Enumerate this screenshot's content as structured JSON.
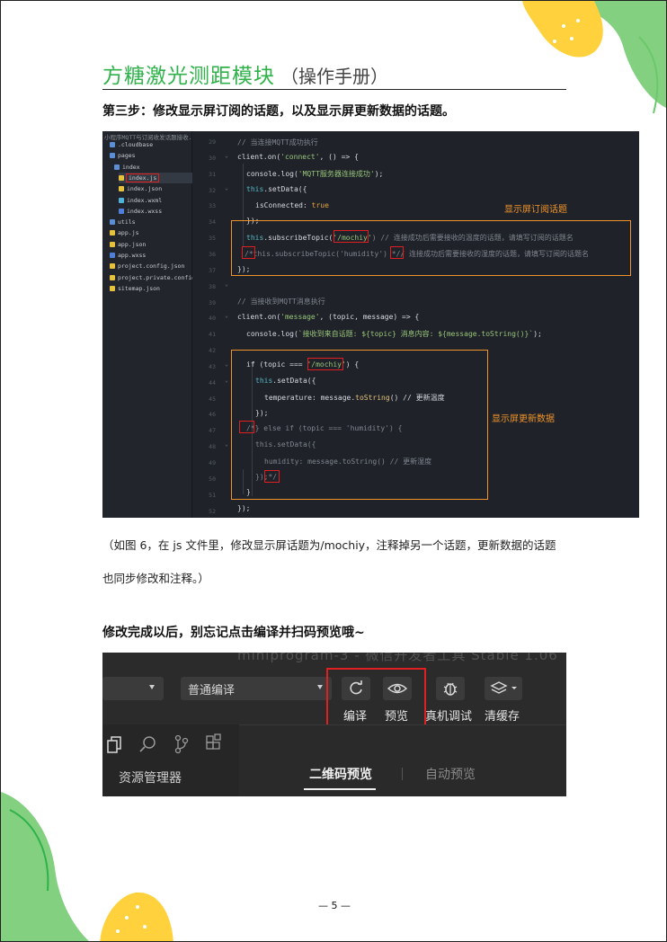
{
  "header": {
    "title": "方糖激光测距模块",
    "subtitle": "（操作手册）"
  },
  "step": {
    "heading": "第三步：修改显示屏订阅的话题，以及显示屏更新数据的话题。"
  },
  "editor": {
    "tree_header": "小程序MQTT与订阅收发话题接收...",
    "tree": [
      {
        "label": ".cloudbase",
        "kind": "folder"
      },
      {
        "label": "pages",
        "kind": "folder"
      },
      {
        "label": "index",
        "kind": "folder"
      },
      {
        "label": "index.js",
        "kind": "js"
      },
      {
        "label": "index.json",
        "kind": "json"
      },
      {
        "label": "index.wxml",
        "kind": "wxml"
      },
      {
        "label": "index.wxss",
        "kind": "wxss"
      },
      {
        "label": "utils",
        "kind": "folder"
      },
      {
        "label": "app.js",
        "kind": "js"
      },
      {
        "label": "app.json",
        "kind": "json"
      },
      {
        "label": "app.wxss",
        "kind": "wxss"
      },
      {
        "label": "project.config.json",
        "kind": "json"
      },
      {
        "label": "project.private.config.js...",
        "kind": "json"
      },
      {
        "label": "sitemap.json",
        "kind": "json"
      }
    ],
    "line_numbers": [
      "29",
      "30",
      "31",
      "32",
      "33",
      "34",
      "35",
      "36",
      "37",
      "38",
      "39",
      "40",
      "41",
      "42",
      "43",
      "44",
      "45",
      "46",
      "47",
      "48",
      "49",
      "50",
      "51",
      "52"
    ],
    "code_lines": {
      "l1": "// 当连接MQTT成功执行",
      "l2a": "client.on(",
      "l2b": "'connect'",
      "l2c": ", () => {",
      "l3a": "console.log(",
      "l3b": "'MQTT服务器连接成功'",
      "l3c": ");",
      "l4a": "this",
      "l4b": ".setData({",
      "l5a": "isConnected: ",
      "l5b": "true",
      "l6": "});",
      "l7a": "this",
      "l7b": ".subscribeTopic(",
      "l7c": "'/mochiy'",
      "l7d": ") // 连接成功后需要接收的温度的话题，请填写订阅的话题名",
      "l8a": "/*",
      "l8b": "this.subscribeTopic('humidity') ",
      "l8c": "*/",
      "l8d": "/ 连接成功后需要接收的湿度的话题，请填写订阅的话题名",
      "l9": "});",
      "l10": "// 当接收到MQTT消息执行",
      "l11a": "client.on(",
      "l11b": "'message'",
      "l11c": ", (topic, message) => {",
      "l12a": "console.log(",
      "l12b": "`接收到来自话题: ${topic} 消息内容: ${message.toString()}`",
      "l12c": ");",
      "l13a": "if (topic === ",
      "l13b": "'/mochiy'",
      "l13c": ") {",
      "l14a": "this",
      "l14b": ".setData({",
      "l15a": "temperature: message.",
      "l15b": "toString",
      "l15c": "() // 更新温度",
      "l16": "});",
      "l17a": "/*",
      "l17b": "} else if (topic === 'humidity') {",
      "l18a": "this",
      "l18b": ".setData({",
      "l19": "humidity: message.toString() // 更新湿度",
      "l20a": "});",
      "l20b": "*/",
      "l21": "}",
      "l22": "});"
    },
    "annotations": {
      "subscribe": "显示屏订阅话题",
      "update": "显示屏更新数据"
    }
  },
  "paragraph": {
    "line1": "（如图 6，在 js 文件里，修改显示屏话题为/mochiy，注释掉另一个话题，更新数据的话题",
    "line2": "也同步修改和注释。）"
  },
  "reminder": "修改完成以后，别忘记点击编译并扫码预览哦~",
  "toolbar": {
    "blurred_title": "miniprogram-3 - 微信开发者工具 Stable 1.06",
    "compile_mode": "普通编译",
    "buttons": [
      {
        "label": "编译",
        "icon": "refresh-icon"
      },
      {
        "label": "预览",
        "icon": "eye-icon"
      },
      {
        "label": "真机调试",
        "icon": "bug-icon"
      },
      {
        "label": "清缓存",
        "icon": "layers-icon"
      }
    ],
    "left_panel_label": "资源管理器",
    "tabs": [
      "二维码预览",
      "自动预览"
    ],
    "colors": {
      "highlight": "#e02020",
      "accent": "#f0932b",
      "brand_green": "#2fb24a"
    }
  },
  "footer": {
    "page_number": "— 5 —"
  }
}
